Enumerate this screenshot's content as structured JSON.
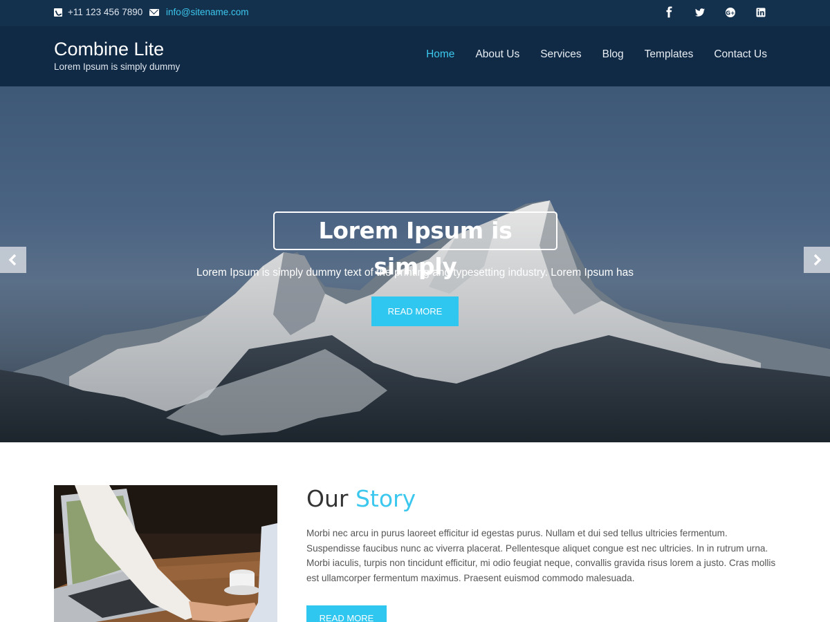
{
  "topbar": {
    "phone": "+11 123 456 7890",
    "email": "info@sitename.com",
    "social_icons": [
      "facebook-icon",
      "twitter-icon",
      "google-plus-icon",
      "linkedin-icon"
    ]
  },
  "header": {
    "site_title": "Combine Lite",
    "tagline": "Lorem Ipsum is simply dummy",
    "nav": [
      {
        "label": "Home",
        "active": true
      },
      {
        "label": "About Us"
      },
      {
        "label": "Services"
      },
      {
        "label": "Blog"
      },
      {
        "label": "Templates"
      },
      {
        "label": "Contact Us"
      }
    ]
  },
  "hero": {
    "title": "Lorem Ipsum is simply",
    "text": "Lorem Ipsum is simply dummy text of the printing and typesetting industry. Lorem Ipsum has",
    "button": "READ MORE"
  },
  "story": {
    "title_part1": "Our",
    "title_part2": "Story",
    "text": "Morbi nec arcu in purus laoreet efficitur id egestas purus. Nullam et dui sed tellus ultricies fermentum. Suspendisse faucibus nunc ac viverra placerat. Pellentesque aliquet congue est nec ultricies. In in rutrum urna. Morbi iaculis, turpis non tincidunt efficitur, mi odio feugiat neque, convallis gravida risus lorem a justo. Cras mollis est ullamcorper fermentum maximus. Praesent euismod commodo malesuada.",
    "button": "READ MORE"
  },
  "colors": {
    "topbar_bg": "#13304d",
    "header_bg": "#102a45",
    "accent": "#3cc8ee",
    "button": "#2fc6f0"
  }
}
